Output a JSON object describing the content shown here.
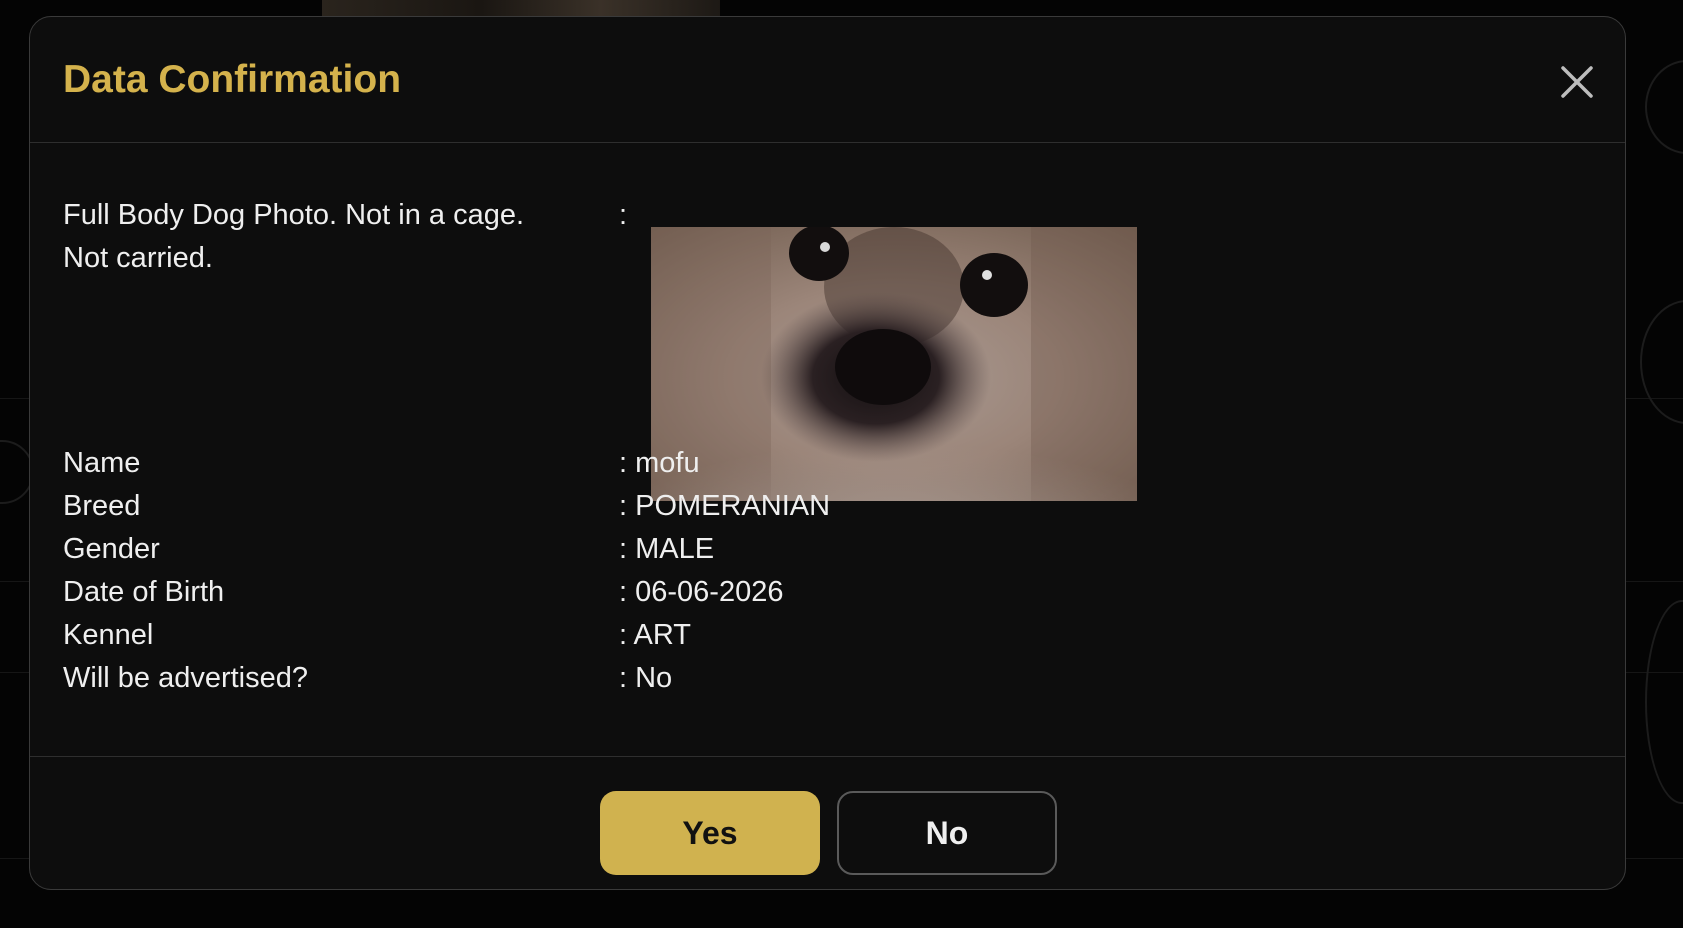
{
  "modal": {
    "title": "Data Confirmation",
    "close_icon": "close-icon",
    "photo": {
      "label": "Full Body Dog Photo. Not in a cage. Not carried.",
      "colon": ":"
    },
    "details": [
      {
        "label": "Name",
        "value": ": mofu"
      },
      {
        "label": "Breed",
        "value": ": POMERANIAN"
      },
      {
        "label": "Gender",
        "value": ": MALE"
      },
      {
        "label": "Date of Birth",
        "value": ": 06-06-2026"
      },
      {
        "label": "Kennel",
        "value": ": ART"
      },
      {
        "label": "Will be advertised?",
        "value": ": No"
      }
    ],
    "buttons": {
      "yes_label": "Yes",
      "no_label": "No"
    }
  },
  "colors": {
    "accent": "#d4b24c",
    "background": "#0d0d0d",
    "text": "#efefef"
  }
}
